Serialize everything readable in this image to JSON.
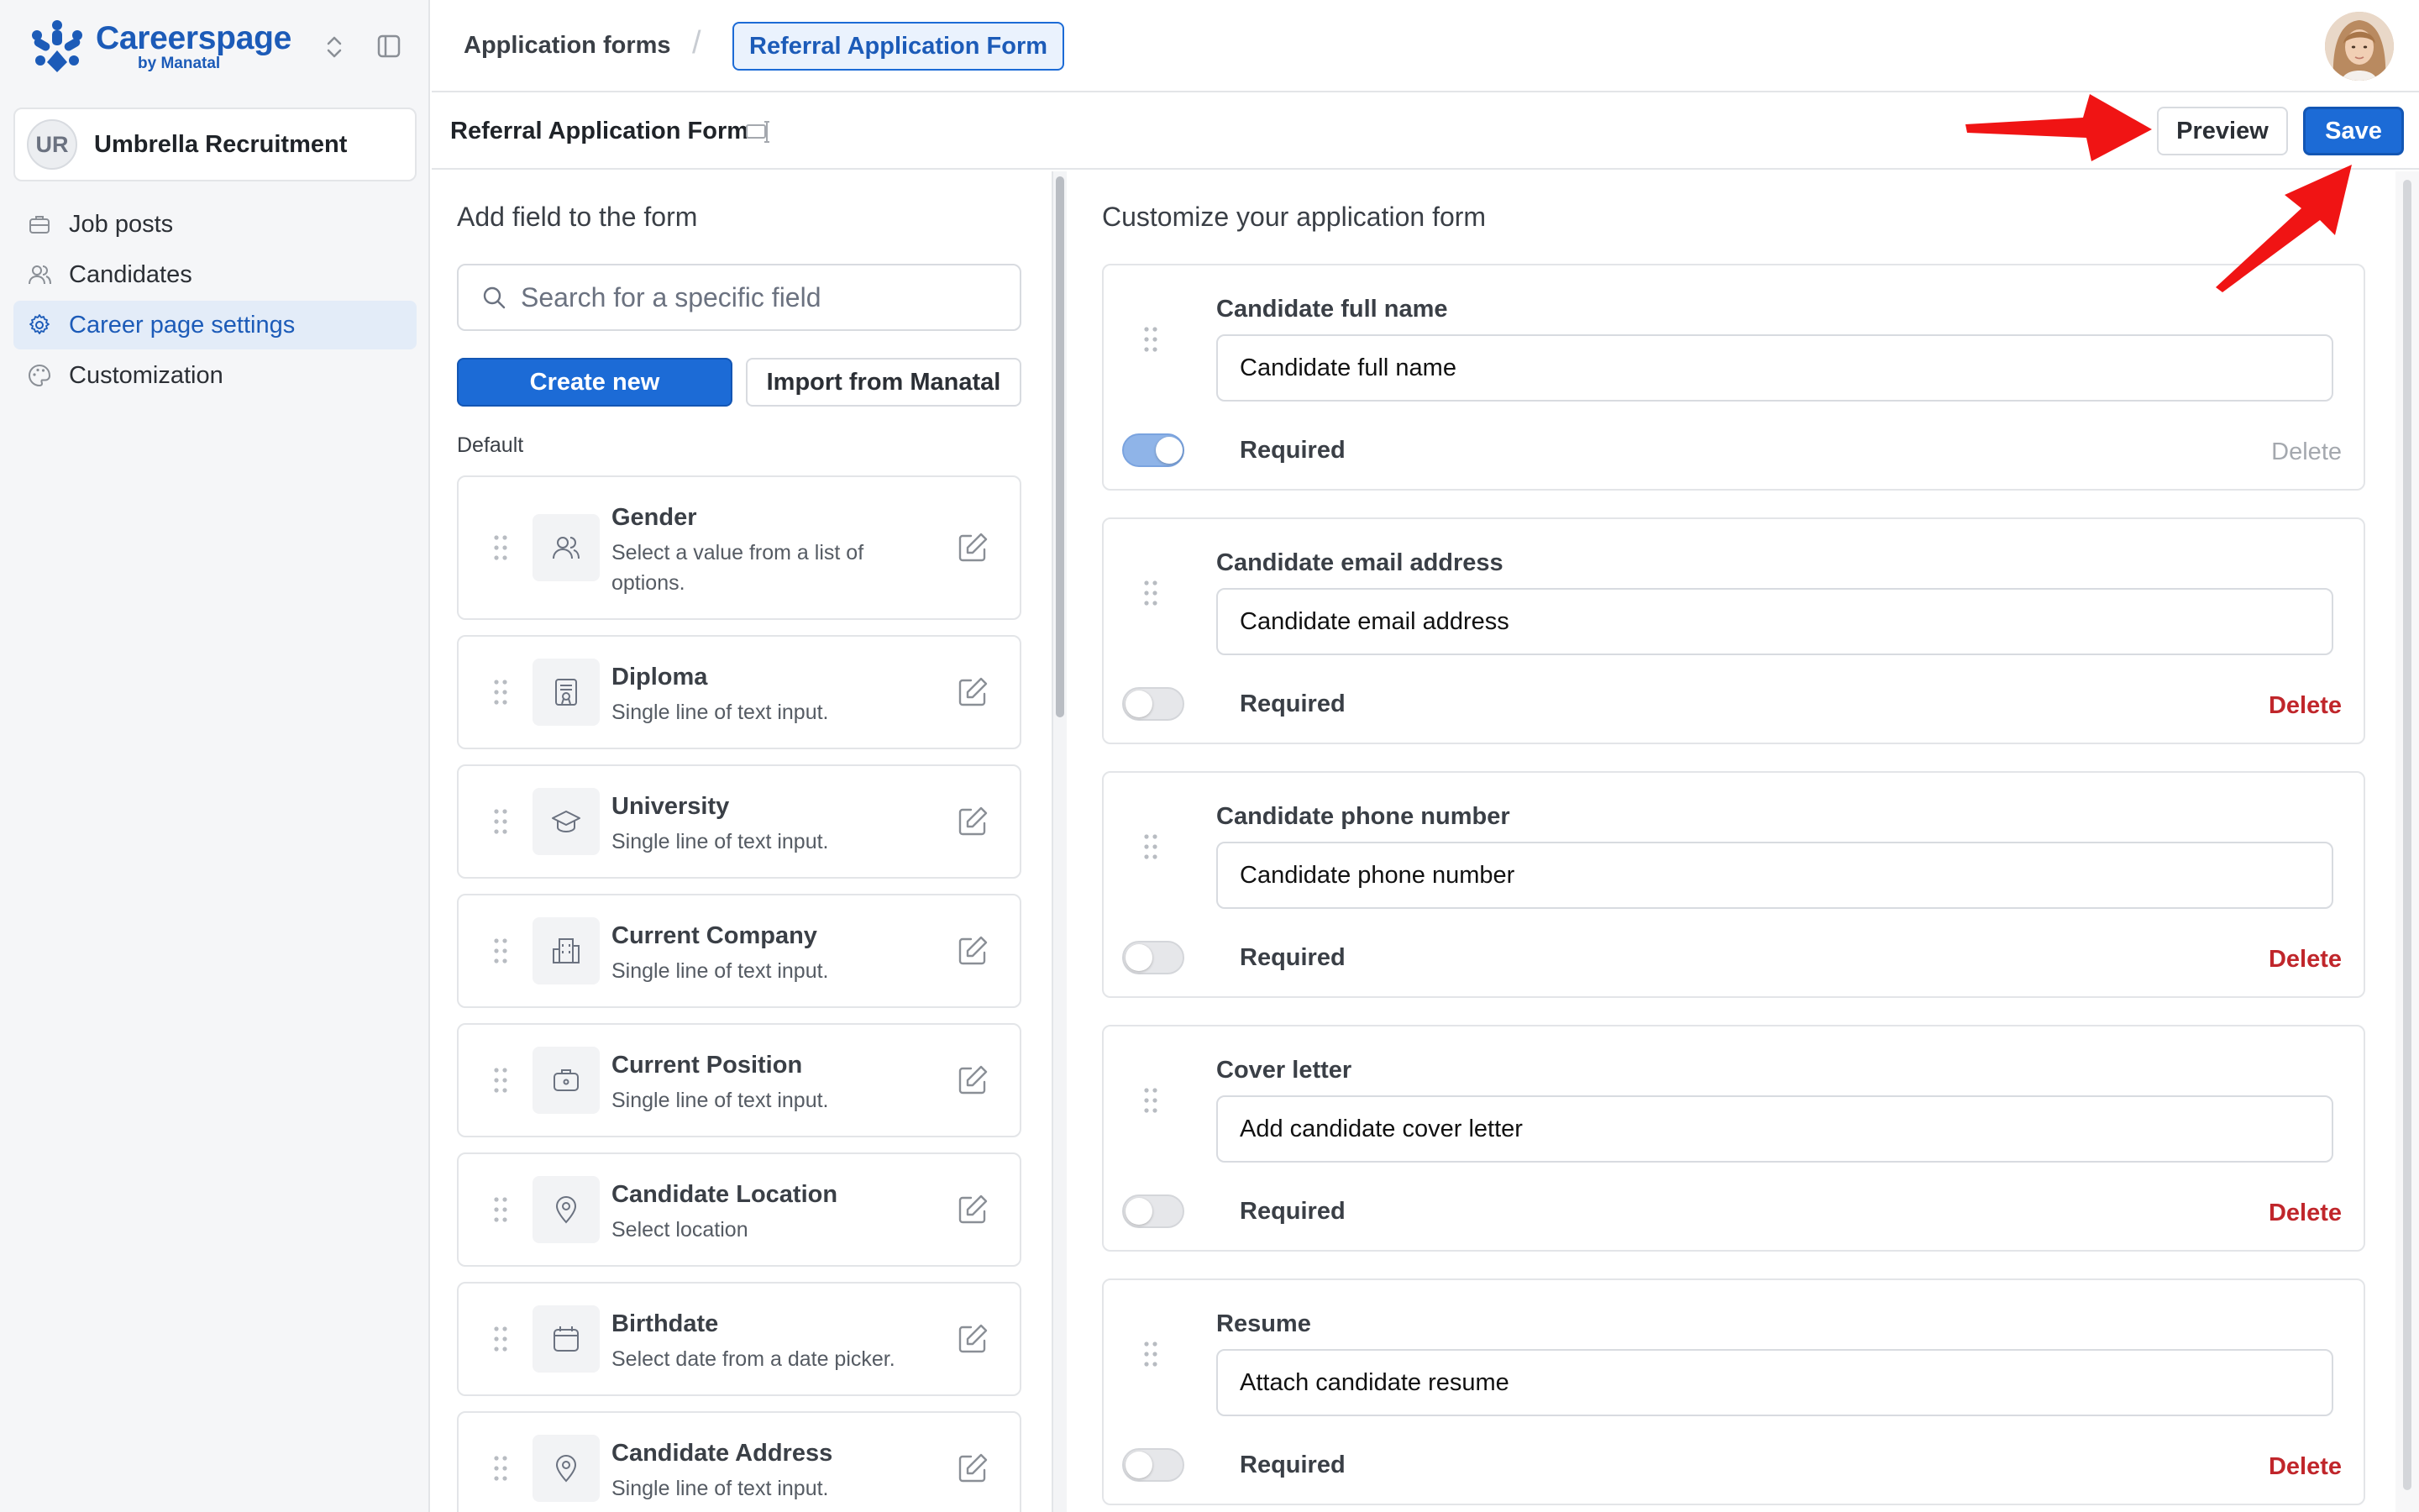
{
  "brand": {
    "name": "Careerspage",
    "sub": "by Manatal",
    "color": "#1c5bb8"
  },
  "organization": {
    "initials": "UR",
    "name": "Umbrella Recruitment"
  },
  "sidebar": {
    "items": [
      {
        "label": "Job posts",
        "icon": "briefcase-icon",
        "active": false
      },
      {
        "label": "Candidates",
        "icon": "users-icon",
        "active": false
      },
      {
        "label": "Career page settings",
        "icon": "gear-icon",
        "active": true
      },
      {
        "label": "Customization",
        "icon": "palette-icon",
        "active": false
      }
    ]
  },
  "breadcrumb": {
    "parent": "Application forms",
    "separator": "/",
    "current": "Referral Application Form"
  },
  "subheader": {
    "title": "Referral Application Form",
    "preview_label": "Preview",
    "save_label": "Save"
  },
  "field_panel": {
    "heading": "Add field to the form",
    "search_placeholder": "Search for a specific field",
    "create_label": "Create new",
    "import_label": "Import from Manatal",
    "section_label": "Default",
    "fields": [
      {
        "name": "Gender",
        "description": "Select a value from a list of options.",
        "icon": "users-icon"
      },
      {
        "name": "Diploma",
        "description": "Single line of text input.",
        "icon": "certificate-icon"
      },
      {
        "name": "University",
        "description": "Single line of text input.",
        "icon": "graduation-cap-icon"
      },
      {
        "name": "Current Company",
        "description": "Single line of text input.",
        "icon": "building-icon"
      },
      {
        "name": "Current Position",
        "description": "Single line of text input.",
        "icon": "briefcase-icon"
      },
      {
        "name": "Candidate Location",
        "description": "Select location",
        "icon": "map-pin-icon"
      },
      {
        "name": "Birthdate",
        "description": "Select date from a date picker.",
        "icon": "calendar-icon"
      },
      {
        "name": "Candidate Address",
        "description": "Single line of text input.",
        "icon": "map-pin-icon"
      }
    ]
  },
  "form_panel": {
    "heading": "Customize your application form",
    "required_label": "Required",
    "delete_label": "Delete",
    "fields": [
      {
        "label": "Candidate full name",
        "placeholder": "Candidate full name",
        "required": true,
        "delete_enabled": false
      },
      {
        "label": "Candidate email address",
        "placeholder": "Candidate email address",
        "required": false,
        "delete_enabled": true
      },
      {
        "label": "Candidate phone number",
        "placeholder": "Candidate phone number",
        "required": false,
        "delete_enabled": true
      },
      {
        "label": "Cover letter",
        "placeholder": "Add candidate cover letter",
        "required": false,
        "delete_enabled": true
      },
      {
        "label": "Resume",
        "placeholder": "Attach candidate resume",
        "required": false,
        "delete_enabled": true
      }
    ]
  },
  "colors": {
    "accent": "#1c6bd6",
    "danger": "#c0262b",
    "annotation": "#f01414"
  }
}
